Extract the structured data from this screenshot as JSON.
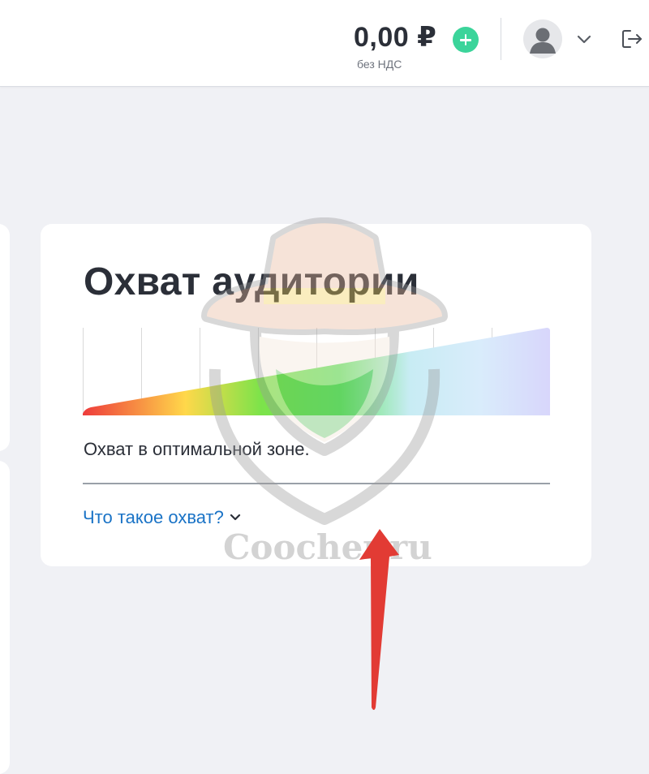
{
  "header": {
    "balance": "0,00 ₽",
    "vat_note": "без НДС",
    "add_funds_icon": "plus-circle-icon",
    "avatar_icon": "user-avatar-icon",
    "menu_icon": "chevron-down-icon",
    "logout_icon": "logout-icon"
  },
  "card": {
    "title": "Охват аудитории",
    "reach_level": 0.5,
    "status": "Охват в оптимальной зоне.",
    "help_link": "Что такое охват?"
  },
  "watermark": {
    "text": "Coocher.ru"
  },
  "colors": {
    "accent_green": "#3bd49a",
    "link_blue": "#1a73c6",
    "background": "#f0f1f5",
    "annotation_red": "#e23b34"
  }
}
